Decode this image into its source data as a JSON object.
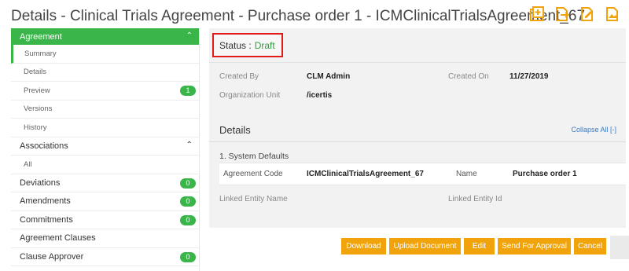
{
  "header": {
    "title": "Details - Clinical Trials Agreement - Purchase order 1 - ICMClinicalTrialsAgreement_67",
    "icons": [
      "add-document-icon",
      "export-document-icon",
      "edit-document-icon",
      "image-document-icon"
    ]
  },
  "sidebar": {
    "agreement_header": "Agreement",
    "agreement_items": [
      {
        "label": "Summary",
        "badge": ""
      },
      {
        "label": "Details",
        "badge": ""
      },
      {
        "label": "Preview",
        "badge": "1"
      },
      {
        "label": "Versions",
        "badge": ""
      },
      {
        "label": "History",
        "badge": ""
      }
    ],
    "associations_header": "Associations",
    "associations_items": [
      {
        "label": "All"
      }
    ],
    "sections": [
      {
        "label": "Deviations",
        "badge": "0"
      },
      {
        "label": "Amendments",
        "badge": "0"
      },
      {
        "label": "Commitments",
        "badge": "0"
      },
      {
        "label": "Agreement Clauses",
        "badge": ""
      },
      {
        "label": "Clause Approver",
        "badge": "0"
      }
    ]
  },
  "main": {
    "status_label": "Status :",
    "status_value": "Draft",
    "created_by_label": "Created By",
    "created_by_value": "CLM Admin",
    "created_on_label": "Created On",
    "created_on_value": "11/27/2019",
    "org_unit_label": "Organization Unit",
    "org_unit_value": "/icertis",
    "details_title": "Details",
    "collapse_all": "Collapse All [-]",
    "system_defaults_title": "1. System Defaults",
    "agreement_code_label": "Agreement Code",
    "agreement_code_value": "ICMClinicalTrialsAgreement_67",
    "name_label": "Name",
    "name_value": "Purchase order 1",
    "linked_entity_name_label": "Linked Entity Name",
    "linked_entity_id_label": "Linked Entity Id"
  },
  "actions": {
    "download": "Download",
    "upload_document": "Upload Document",
    "edit": "Edit",
    "send_for_approval": "Send For Approval",
    "cancel": "Cancel"
  },
  "colors": {
    "accent_green": "#3ab54a",
    "action_orange": "#f0a30a",
    "status_highlight": "#e01b1b"
  }
}
